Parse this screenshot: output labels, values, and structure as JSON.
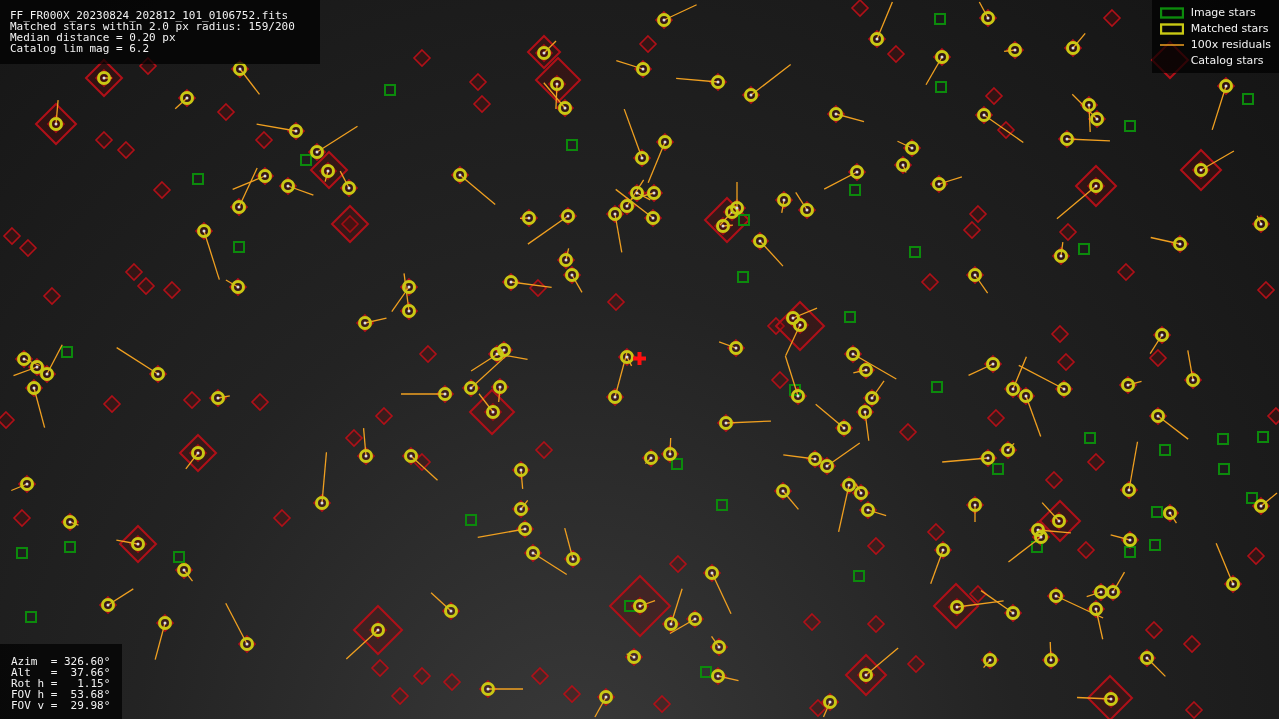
{
  "info": {
    "lines": [
      "FF_FR000X_20230824_202812_101_0106752.fits",
      "Matched stars within 2.0 px radius: 159/200",
      "Median distance = 0.20 px",
      "Catalog lim mag = 6.2"
    ]
  },
  "legend": {
    "items": [
      {
        "kind": "image",
        "label": "Image stars"
      },
      {
        "kind": "matched",
        "label": "Matched stars"
      },
      {
        "kind": "residual",
        "label": "100x residuals"
      },
      {
        "kind": "catalog",
        "label": "Catalog stars"
      }
    ]
  },
  "pointing": {
    "lines": [
      "Azim  = 326.60°",
      "Alt   =  37.66°",
      "Rot h =   1.15°",
      "FOV h =  53.68°",
      "FOV v =  29.98°"
    ]
  }
}
